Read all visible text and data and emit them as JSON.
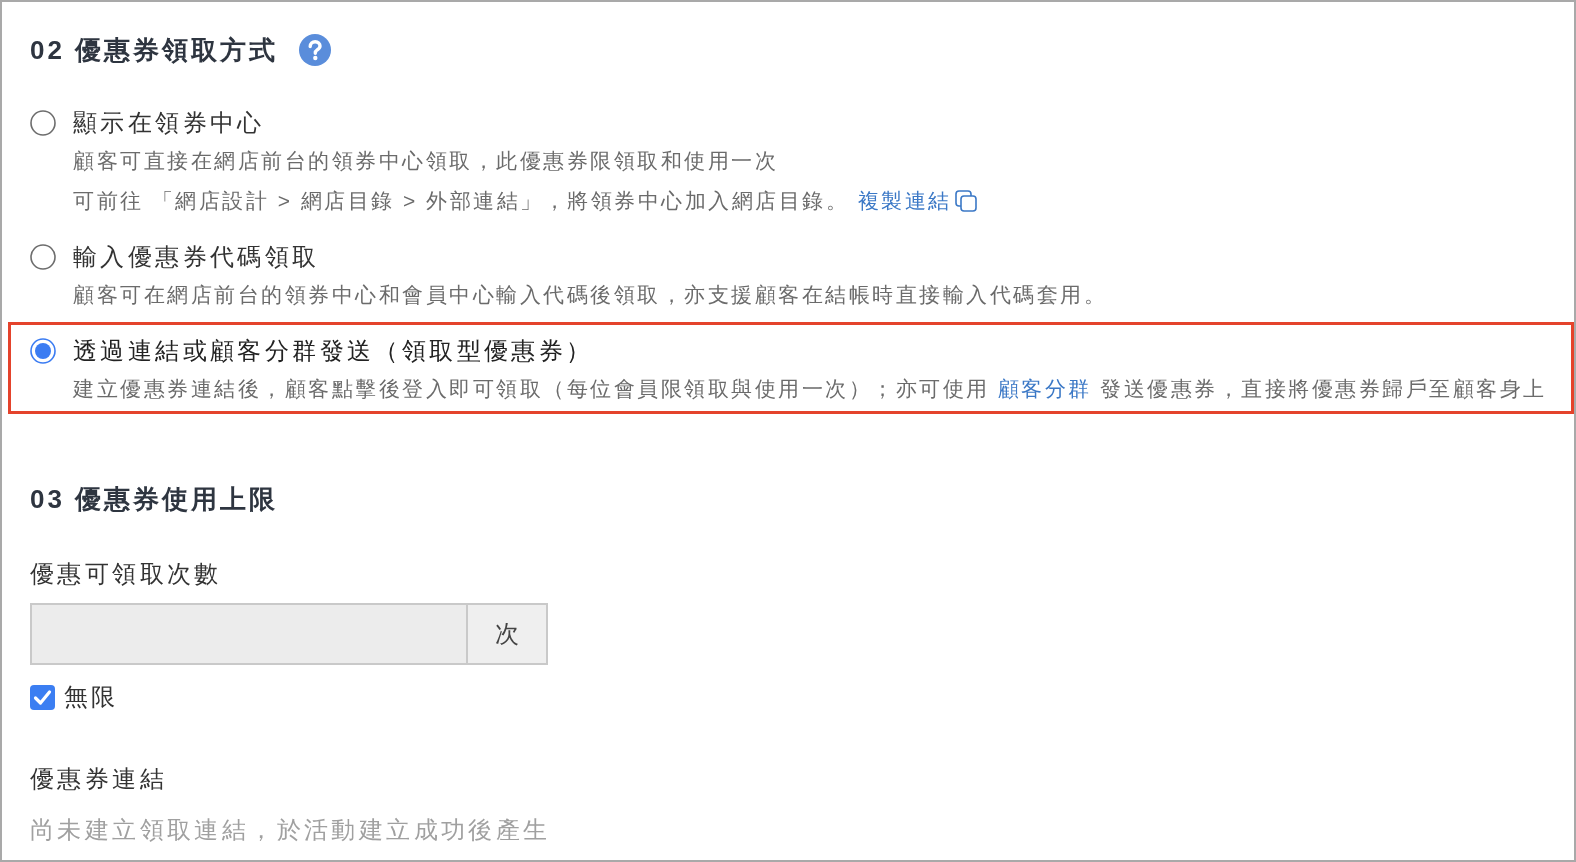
{
  "claim_method": {
    "title": "02 優惠券領取方式",
    "options": [
      {
        "label": "顯示在領券中心",
        "selected": false,
        "highlighted": false,
        "description": [
          [
            {
              "kind": "text",
              "text": "顧客可直接在網店前台的領券中心領取，此優惠券限領取和使用一次"
            }
          ],
          [
            {
              "kind": "text",
              "text": "可前往 「網店設計 > 網店目錄 > 外部連結」，將領券中心加入網店目錄。 "
            },
            {
              "kind": "copy_link",
              "text": "複製連結"
            }
          ]
        ]
      },
      {
        "label": "輸入優惠券代碼領取",
        "selected": false,
        "highlighted": false,
        "description": [
          [
            {
              "kind": "text",
              "text": "顧客可在網店前台的領券中心和會員中心輸入代碼後領取，亦支援顧客在結帳時直接輸入代碼套用。"
            }
          ]
        ]
      },
      {
        "label": "透過連結或顧客分群發送（領取型優惠券）",
        "selected": true,
        "highlighted": true,
        "description": [
          [
            {
              "kind": "text",
              "text": "建立優惠券連結後，顧客點擊後登入即可領取（每位會員限領取與使用一次）；亦可使用 "
            },
            {
              "kind": "link",
              "text": "顧客分群"
            },
            {
              "kind": "text",
              "text": " 發送優惠券，直接將優惠券歸戶至顧客身上"
            }
          ]
        ]
      }
    ]
  },
  "usage_limit": {
    "title": "03 優惠券使用上限",
    "claim_count": {
      "label": "優惠可領取次數",
      "disabled": true,
      "unit": "次",
      "unlimited": {
        "label": "無限",
        "checked": true
      }
    },
    "coupon_link": {
      "label": "優惠券連結",
      "note": "尚未建立領取連結，於活動建立成功後產生"
    }
  }
}
